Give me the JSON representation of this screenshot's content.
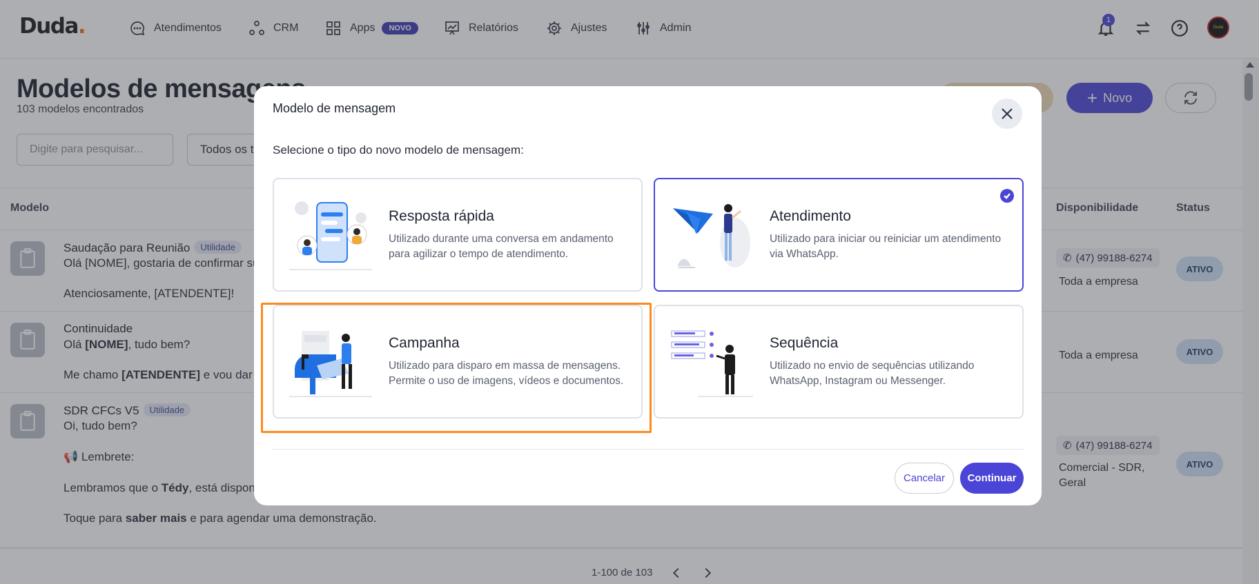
{
  "app": {
    "logo_text": "Duda",
    "logo_dot": "."
  },
  "nav": {
    "items": [
      {
        "label": "Atendimentos",
        "icon": "chat-bubble-icon"
      },
      {
        "label": "CRM",
        "icon": "crm-nodes-icon"
      },
      {
        "label": "Apps",
        "icon": "grid-icon",
        "badge": "NOVO"
      },
      {
        "label": "Relatórios",
        "icon": "chart-board-icon"
      },
      {
        "label": "Ajustes",
        "icon": "gear-icon"
      },
      {
        "label": "Admin",
        "icon": "sliders-icon"
      }
    ],
    "notification_count": "1",
    "avatar_text": "Duda"
  },
  "page": {
    "title": "Modelos de mensagens",
    "subtitle": "103 modelos encontrados",
    "new_button": "Novo",
    "search_placeholder": "Digite para pesquisar...",
    "filter_label": "Todos os ti"
  },
  "table": {
    "columns": {
      "model": "Modelo",
      "availability": "Disponibilidade",
      "status": "Status"
    },
    "rows": [
      {
        "title": "Saudação para Reunião",
        "tag": "Utilidade",
        "line1": "Olá [NOME], gostaria de confirmar su",
        "line2": "Atenciosamente, [ATENDENTE]!",
        "phone": "(47) 99188-6274",
        "availability": "Toda a empresa",
        "status": "ATIVO"
      },
      {
        "title": "Continuidade",
        "line1_a": "Olá ",
        "line1_b": "[NOME]",
        "line1_c": ", tudo bem?",
        "line2_a": "Me chamo ",
        "line2_b": "[ATENDENTE]",
        "line2_c": " e vou dar s",
        "availability": "Toda a empresa",
        "status": "ATIVO"
      },
      {
        "title": "SDR CFCs V5",
        "tag": "Utilidade",
        "line1": "Oi, tudo bem?",
        "line2": "📢 Lembrete:",
        "line3_a": "Lembramos que o ",
        "line3_b": "Tédy",
        "line3_c": ", está disponí",
        "line4_a": "Toque para ",
        "line4_b": "saber mais",
        "line4_c": " e para agendar uma demonstração.",
        "phone": "(47) 99188-6274",
        "availability_1": "Comercial - SDR,",
        "availability_2": "Geral",
        "status": "ATIVO"
      }
    ]
  },
  "pagination": {
    "range": "1-100 de 103"
  },
  "modal": {
    "title": "Modelo de mensagem",
    "subtitle": "Selecione o tipo do novo modelo de mensagem:",
    "options": [
      {
        "title": "Resposta rápida",
        "description": "Utilizado durante uma conversa em andamento para agilizar o tempo de atendimento.",
        "selected": false
      },
      {
        "title": "Atendimento",
        "description": "Utilizado para iniciar ou reiniciar um atendimento via WhatsApp.",
        "selected": true
      },
      {
        "title": "Campanha",
        "description": "Utilizado para disparo em massa de mensagens. Permite o uso de imagens, vídeos e documentos.",
        "selected": false
      },
      {
        "title": "Sequência",
        "description": "Utilizado no envio de sequências utilizando WhatsApp, Instagram ou Messenger.",
        "selected": false
      }
    ],
    "cancel_label": "Cancelar",
    "continue_label": "Continuar"
  },
  "colors": {
    "primary": "#4a45d6",
    "highlight": "#ff8a1c",
    "brand_dot": "#f26d21",
    "status_bg": "#cfe2f8"
  }
}
